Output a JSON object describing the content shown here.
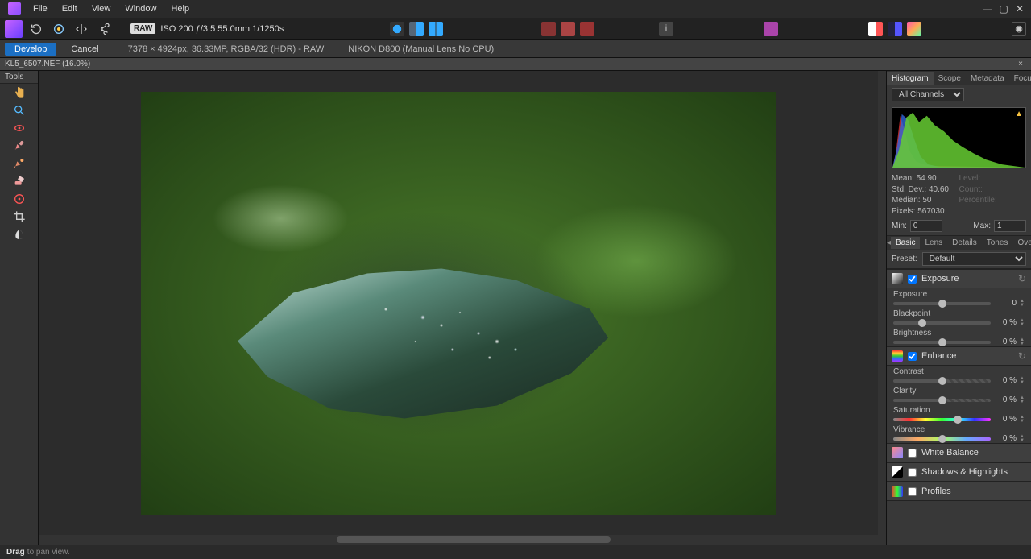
{
  "menubar": {
    "items": [
      "File",
      "Edit",
      "View",
      "Window",
      "Help"
    ]
  },
  "toolbar": {
    "raw_badge": "RAW",
    "raw_meta": "ISO 200 ƒ/3.5 55.0mm 1/1250s"
  },
  "actionbar": {
    "develop": "Develop",
    "cancel": "Cancel",
    "dims": "7378 × 4924px, 36.33MP, RGBA/32 (HDR) - RAW",
    "camera": "NIKON D800 (Manual Lens No CPU)"
  },
  "document_tab": "KL5_6507.NEF (16.0%)",
  "tools_panel": {
    "title": "Tools"
  },
  "right_panel": {
    "tabs": [
      "Histogram",
      "Scope",
      "Metadata",
      "Focus"
    ],
    "channel_label": "All Channels",
    "stats": {
      "mean_label": "Mean:",
      "mean": "54.90",
      "std_label": "Std. Dev.:",
      "std": "40.60",
      "median_label": "Median:",
      "median": "50",
      "pixels_label": "Pixels:",
      "pixels": "567030",
      "level_label": "Level:",
      "count_label": "Count:",
      "pct_label": "Percentile:"
    },
    "min_label": "Min:",
    "min_val": "0",
    "max_label": "Max:",
    "max_val": "1",
    "adjust_tabs": [
      "Basic",
      "Lens",
      "Details",
      "Tones",
      "Overlays"
    ],
    "preset_label": "Preset:",
    "preset_value": "Default",
    "exposure": {
      "header": "Exposure",
      "sliders": [
        {
          "label": "Exposure",
          "value": "0",
          "thumb": 50
        },
        {
          "label": "Blackpoint",
          "value": "0 %",
          "thumb": 30
        },
        {
          "label": "Brightness",
          "value": "0 %",
          "thumb": 50
        }
      ]
    },
    "enhance": {
      "header": "Enhance",
      "sliders": [
        {
          "label": "Contrast",
          "value": "0 %",
          "thumb": 50,
          "style": "half-hatched"
        },
        {
          "label": "Clarity",
          "value": "0 %",
          "thumb": 50,
          "style": "half-hatched"
        },
        {
          "label": "Saturation",
          "value": "0 %",
          "thumb": 66,
          "style": "sat"
        },
        {
          "label": "Vibrance",
          "value": "0 %",
          "thumb": 50,
          "style": "vib"
        }
      ]
    },
    "white_balance": "White Balance",
    "shadows_highlights": "Shadows & Highlights",
    "profiles": "Profiles"
  },
  "statusbar": {
    "strong": "Drag",
    "rest": "to pan view."
  }
}
